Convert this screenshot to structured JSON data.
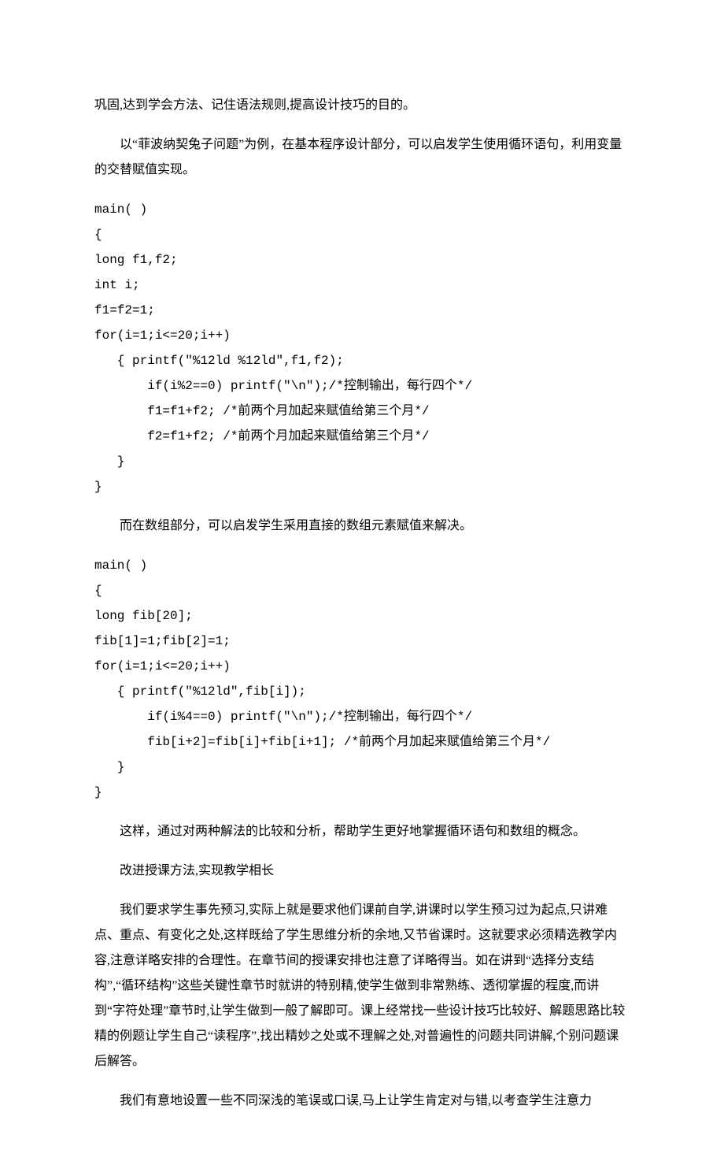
{
  "p1": "巩固,达到学会方法、记住语法规则,提高设计技巧的目的。",
  "p2": "以“菲波纳契兔子问题”为例，在基本程序设计部分，可以启发学生使用循环语句，利用变量的交替赋值实现。",
  "code1": [
    "main( )",
    "{",
    "long f1,f2;",
    "int i;",
    "f1=f2=1;",
    "for(i=1;i<=20;i++)",
    "   { printf(\"%12ld %12ld\",f1,f2);",
    "       if(i%2==0) printf(\"\\n\");/*控制输出，每行四个*/",
    "       f1=f1+f2; /*前两个月加起来赋值给第三个月*/",
    "       f2=f1+f2; /*前两个月加起来赋值给第三个月*/",
    "   }",
    "}"
  ],
  "p3": "而在数组部分，可以启发学生采用直接的数组元素赋值来解决。",
  "code2": [
    "main( )",
    "{",
    "long fib[20];",
    "fib[1]=1;fib[2]=1;",
    "for(i=1;i<=20;i++)",
    "   { printf(\"%12ld\",fib[i]);",
    "       if(i%4==0) printf(\"\\n\");/*控制输出，每行四个*/",
    "       fib[i+2]=fib[i]+fib[i+1]; /*前两个月加起来赋值给第三个月*/",
    "   }",
    "}"
  ],
  "p4": "这样，通过对两种解法的比较和分析，帮助学生更好地掌握循环语句和数组的概念。",
  "p5": "改进授课方法,实现教学相长",
  "p6": "我们要求学生事先预习,实际上就是要求他们课前自学,讲课时以学生预习过为起点,只讲难点、重点、有变化之处,这样既给了学生思维分析的余地,又节省课时。这就要求必须精选教学内容,注意详略安排的合理性。在章节间的授课安排也注意了详略得当。如在讲到“选择分支结构”,“循环结构”这些关键性章节时就讲的特别精,使学生做到非常熟练、透彻掌握的程度,而讲到“字符处理”章节时,让学生做到一般了解即可。课上经常找一些设计技巧比较好、解题思路比较精的例题让学生自己“读程序”,找出精妙之处或不理解之处,对普遍性的问题共同讲解,个别问题课后解答。",
  "p7": "我们有意地设置一些不同深浅的笔误或口误,马上让学生肯定对与错,以考查学生注意力"
}
